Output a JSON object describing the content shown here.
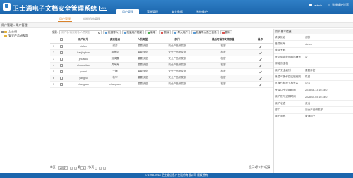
{
  "header": {
    "title": "卫士通电子文档安全管理系统",
    "version": "V3.1",
    "nav": [
      "用户管理",
      "策略管理",
      "安全数据",
      "系统维护"
    ],
    "user_label": "admin",
    "settings_label": "系统维护设置"
  },
  "subnav": {
    "tabs": [
      "用户管理",
      "组织机构管理"
    ]
  },
  "breadcrumb": "用户管理 > 用户管理",
  "tree": {
    "root": "卫士通",
    "child": "安全产品研发部"
  },
  "toolbar": {
    "search_label": "搜索:",
    "search_placeholder": "用户名/真实姓名/人员类型",
    "buttons": [
      "批量导入",
      "批量用户档案",
      "新增",
      "删除",
      "导入用户",
      "批量导入员工信息",
      "删除"
    ]
  },
  "table": {
    "columns": [
      "",
      "",
      "用户帐号",
      "真实姓名",
      "人员类型",
      "部门",
      "最后可操作文件数量",
      "操作"
    ],
    "rows": [
      {
        "num": "1",
        "account": "xiefen",
        "name": "谢芬",
        "type": "重要涉密",
        "dept": "安全产品研发部",
        "count": "机密"
      },
      {
        "num": "2",
        "account": "haojinghua",
        "name": "郝静华",
        "type": "重要涉密",
        "dept": "安全产品研发部",
        "count": "机密"
      },
      {
        "num": "3",
        "account": "jihuanlu",
        "name": "姬焕露",
        "type": "重要涉密",
        "dept": "安全产品研发部",
        "count": "机密"
      },
      {
        "num": "4",
        "account": "zhouhaitao",
        "name": "周海涛",
        "type": "重要涉密",
        "dept": "安全产品研发部",
        "count": "机密"
      },
      {
        "num": "5",
        "account": "yumei",
        "name": "于梅",
        "type": "重要涉密",
        "dept": "安全产品研发部",
        "count": "机密"
      },
      {
        "num": "6",
        "account": "yangyu",
        "name": "杨宇",
        "type": "重要涉密",
        "dept": "安全产品研发部",
        "count": "机密"
      },
      {
        "num": "7",
        "account": "zhangsan",
        "name": "zhangsan",
        "type": "重要涉密",
        "dept": "安全产品研发部",
        "count": "机密"
      }
    ]
  },
  "pager": {
    "per_page_label": "每页:",
    "per_page": "20条",
    "page_label": "第",
    "page_value": "1",
    "of_label": "共1页",
    "total": "显示1到7,共7记录"
  },
  "panel": {
    "title": "用户基本信息",
    "fields": [
      {
        "k": "真实姓名",
        "v": "谢芬"
      },
      {
        "k": "登录帐号",
        "v": "xiefen"
      },
      {
        "k": "电话号码",
        "v": ""
      },
      {
        "k": "是否绑定此电脑机器号",
        "v": "否"
      },
      {
        "k": "绑定的主机",
        "v": ""
      },
      {
        "k": "用户安全级别",
        "v": "重要涉密"
      },
      {
        "k": "最高可操作的文档级别",
        "v": "机密"
      },
      {
        "k": "可操作机密文档签名",
        "v": "5GB"
      },
      {
        "k": "登录口令过期时间",
        "v": "2018-03-13 16:34:07"
      },
      {
        "k": "用户账号过期时间",
        "v": "2028-02-03 16:34:07"
      },
      {
        "k": "用户状态",
        "v": "激活"
      },
      {
        "k": "部门",
        "v": "安全产品研发部"
      },
      {
        "k": "用户角色",
        "v": "普通用户"
      }
    ]
  },
  "footer": "© 1998-2018  卫士通信息产业股份有限公司 版权所有"
}
